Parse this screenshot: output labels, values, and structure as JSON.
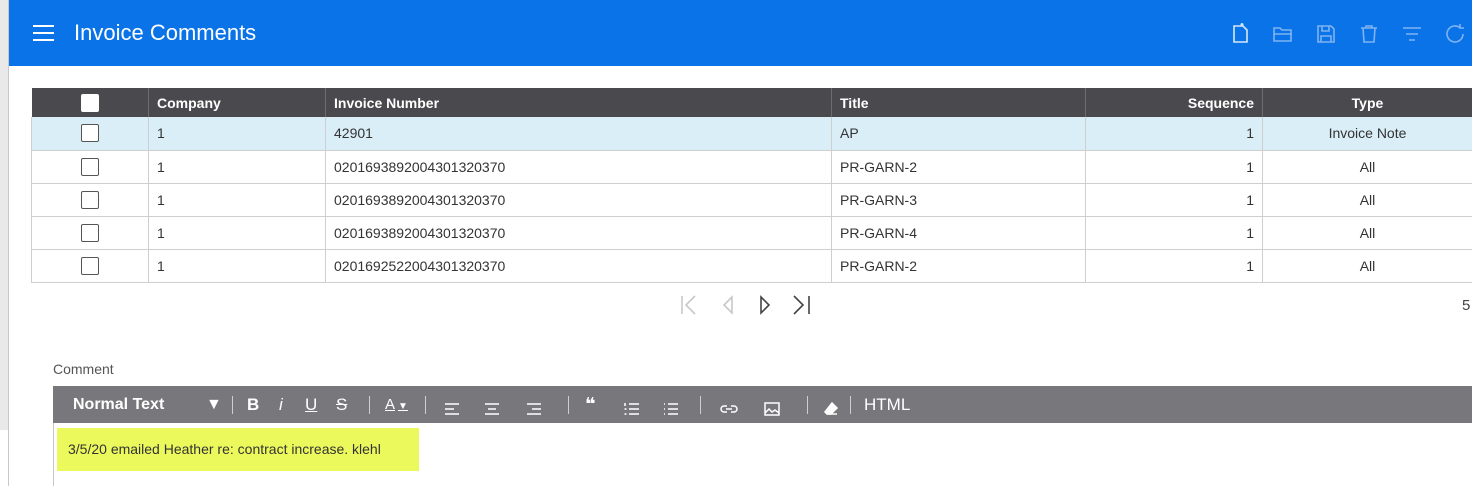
{
  "header": {
    "title": "Invoice Comments",
    "accent_color": "#0a73e8",
    "toolbar_icons": [
      "new-icon",
      "open-folder-icon",
      "save-icon",
      "delete-icon",
      "filter-icon",
      "refresh-icon"
    ]
  },
  "table": {
    "columns": [
      "Company",
      "Invoice Number",
      "Title",
      "Sequence",
      "Type"
    ],
    "rows": [
      {
        "company": "1",
        "invoice_number": "42901",
        "title": "AP",
        "sequence": "1",
        "type": "Invoice Note"
      },
      {
        "company": "1",
        "invoice_number": "0201693892004301320370",
        "title": "PR-GARN-2",
        "sequence": "1",
        "type": "All"
      },
      {
        "company": "1",
        "invoice_number": "0201693892004301320370",
        "title": "PR-GARN-3",
        "sequence": "1",
        "type": "All"
      },
      {
        "company": "1",
        "invoice_number": "0201693892004301320370",
        "title": "PR-GARN-4",
        "sequence": "1",
        "type": "All"
      },
      {
        "company": "1",
        "invoice_number": "0201692522004301320370",
        "title": "PR-GARN-2",
        "sequence": "1",
        "type": "All"
      }
    ]
  },
  "pager": {
    "count": "5"
  },
  "comment": {
    "label": "Comment",
    "toolbar": {
      "format_select": "Normal Text",
      "bold": "B",
      "italic": "i",
      "underline": "U",
      "strike": "S",
      "font_color": "A",
      "html": "HTML"
    },
    "text": "3/5/20 emailed Heather re: contract increase. klehl",
    "highlight_color": "#ecf95c"
  }
}
